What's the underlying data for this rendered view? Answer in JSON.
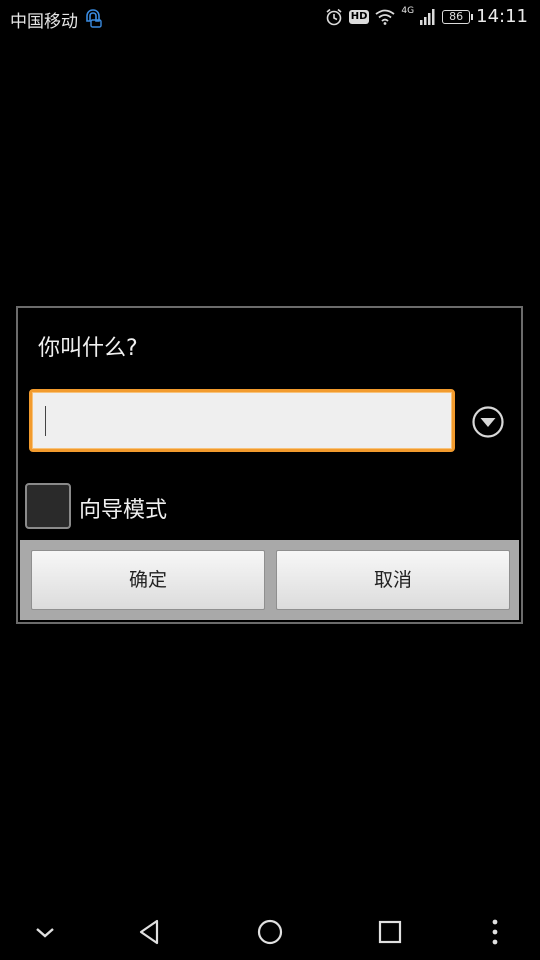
{
  "status_bar": {
    "carrier": "中国移动",
    "network": "4G",
    "battery": "86",
    "time": "14:11",
    "icons": [
      "hd-call-icon",
      "alarm-icon",
      "wifi-icon",
      "signal-icon",
      "battery-icon"
    ]
  },
  "dialog": {
    "title": "你叫什么?",
    "input": {
      "value": "",
      "placeholder": ""
    },
    "checkbox_label": "向导模式",
    "checkbox_checked": false,
    "ok_label": "确定",
    "cancel_label": "取消"
  },
  "colors": {
    "accent": "#f29b2e",
    "background": "#000000",
    "button_bar": "#a9a9a9"
  },
  "nav_bar": {
    "icons": [
      "chevron-down-icon",
      "back-icon",
      "home-icon",
      "recents-icon",
      "more-icon"
    ]
  }
}
